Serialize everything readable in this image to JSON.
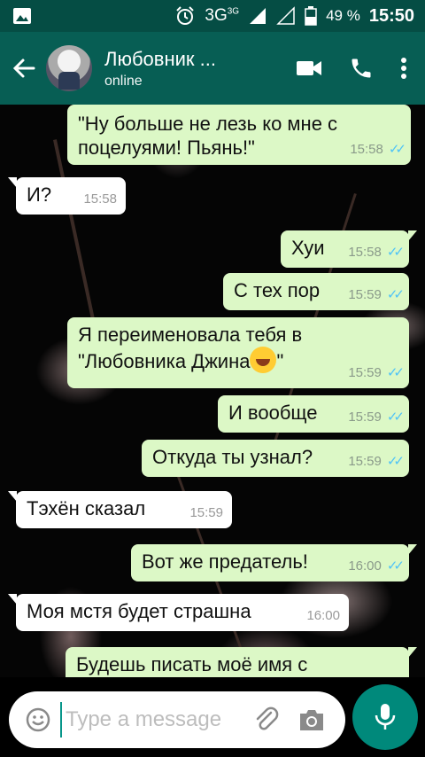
{
  "status_bar": {
    "network": "3G",
    "network_sup": "3G",
    "battery": "49 %",
    "time": "15:50"
  },
  "header": {
    "contact_name": "Любовник ...",
    "status": "online"
  },
  "messages": [
    {
      "direction": "out",
      "text": "\"Ну больше не лезь ко мне с\nпоцелуями! Пьянь!\"",
      "time": "15:58",
      "read": true
    },
    {
      "direction": "in",
      "text": "И?",
      "time": "15:58"
    },
    {
      "direction": "out",
      "text": "Хуи",
      "time": "15:58",
      "read": true
    },
    {
      "direction": "out",
      "text": "С тех пор",
      "time": "15:59",
      "read": true
    },
    {
      "direction": "out",
      "text_line1": "Я переименовала тебя в",
      "text_line2": "\"Любовника Джина",
      "text_line2_end": "\"",
      "emoji": "rofl-emoji",
      "time": "15:59",
      "read": true
    },
    {
      "direction": "out",
      "text": "И вообще",
      "time": "15:59",
      "read": true
    },
    {
      "direction": "out",
      "text": "Откуда ты узнал?",
      "time": "15:59",
      "read": true
    },
    {
      "direction": "in",
      "text": "Тэхён сказал",
      "time": "15:59"
    },
    {
      "direction": "out",
      "text": "Вот же предатель!",
      "time": "16:00",
      "read": true
    },
    {
      "direction": "in",
      "text": "Моя мстя будет страшна",
      "time": "16:00"
    },
    {
      "direction": "out",
      "text": "Будешь писать моё имя с",
      "time": "",
      "read": false
    }
  ],
  "composer": {
    "placeholder": "Type a message"
  },
  "colors": {
    "header": "#075e54",
    "status_bar": "#054d44",
    "outgoing": "#dcf8c6",
    "incoming": "#ffffff",
    "fab": "#00897b",
    "read_tick": "#4fc3f7"
  },
  "icons": [
    "image-icon",
    "alarm-icon",
    "signal-icon",
    "battery-icon",
    "back-arrow-icon",
    "video-call-icon",
    "phone-icon",
    "more-vert-icon",
    "emoji-icon",
    "attach-icon",
    "camera-icon",
    "mic-icon"
  ]
}
